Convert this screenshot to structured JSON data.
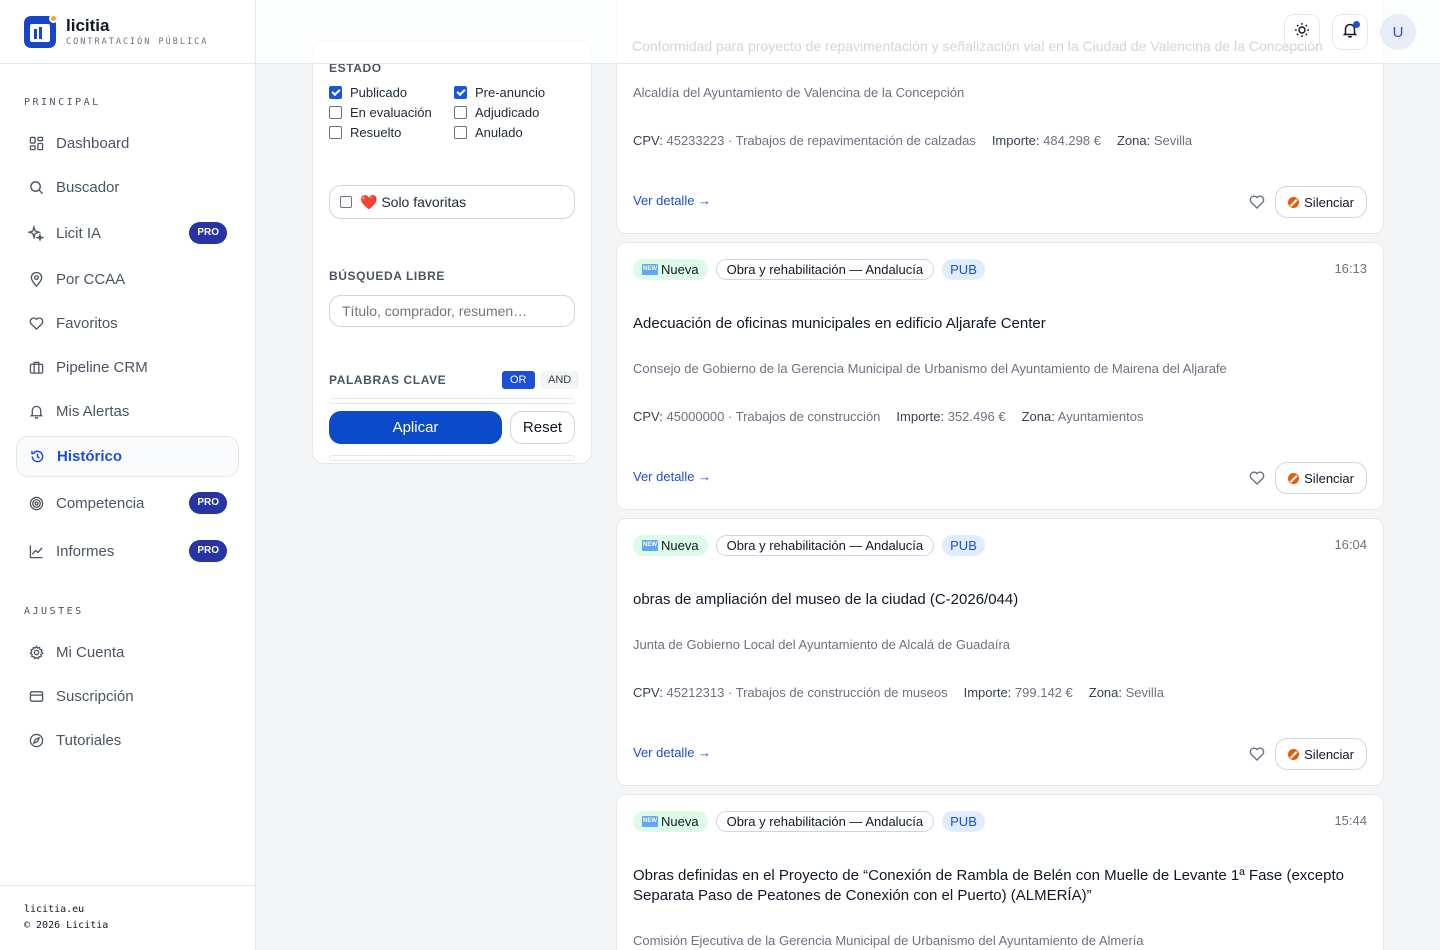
{
  "brand": {
    "name": "licitia",
    "subtitle": "CONTRATACIÓN PÚBLICA"
  },
  "sidebar": {
    "section_main": "PRINCIPAL",
    "section_settings": "AJUSTES",
    "items": [
      {
        "label": "Dashboard",
        "icon": "grid-icon"
      },
      {
        "label": "Buscador",
        "icon": "search-icon"
      },
      {
        "label": "Licit IA",
        "icon": "sparkle-icon",
        "badge": "PRO"
      },
      {
        "label": "Por CCAA",
        "icon": "map-pin-icon"
      },
      {
        "label": "Favoritos",
        "icon": "heart-icon"
      },
      {
        "label": "Pipeline CRM",
        "icon": "briefcase-icon"
      },
      {
        "label": "Mis Alertas",
        "icon": "bell-icon"
      },
      {
        "label": "Histórico",
        "icon": "history-icon",
        "active": true
      },
      {
        "label": "Competencia",
        "icon": "target-icon",
        "badge": "PRO"
      },
      {
        "label": "Informes",
        "icon": "chart-icon",
        "badge": "PRO"
      }
    ],
    "settings_items": [
      {
        "label": "Mi Cuenta",
        "icon": "gear-icon"
      },
      {
        "label": "Suscripción",
        "icon": "card-icon"
      },
      {
        "label": "Tutoriales",
        "icon": "compass-icon"
      }
    ],
    "footer": {
      "site": "licitia.eu",
      "copyright": "© 2026 Licitia"
    }
  },
  "header": {
    "avatar_initial": "U",
    "ghost_text": "Conformidad para proyecto de repavimentación y señalización vial en la Ciudad de Valencina de la Concepción"
  },
  "filters": {
    "estado_label": "ESTADO",
    "estados": [
      {
        "label": "Publicado",
        "checked": true
      },
      {
        "label": "Pre-anuncio",
        "checked": true
      },
      {
        "label": "En evaluación",
        "checked": false
      },
      {
        "label": "Adjudicado",
        "checked": false
      },
      {
        "label": "Resuelto",
        "checked": false
      },
      {
        "label": "Anulado",
        "checked": false
      }
    ],
    "favoritas_label": "❤️ Solo favoritas",
    "busqueda_label": "BÚSQUEDA LIBRE",
    "busqueda_placeholder": "Título, comprador, resumen…",
    "palabras_label": "PALABRAS CLAVE",
    "mode_or": "OR",
    "mode_and": "AND",
    "apply": "Aplicar",
    "reset": "Reset"
  },
  "common": {
    "new_label": "Nueva",
    "new_emoji": "NEW",
    "pub": "PUB",
    "detail_link": "Ver detalle →",
    "silence": "Silenciar",
    "cpv_label": "CPV:",
    "importe_label": "Importe:",
    "zona_label": "Zona:"
  },
  "cards": [
    {
      "org": "Alcaldía del Ayuntamiento de Valencina de la Concepción",
      "cpv": "45233223 · Trabajos de repavimentación de calzadas",
      "importe": "484.298 €",
      "zona": "Sevilla"
    },
    {
      "category": "Obra y rehabilitación — Andalucía",
      "time": "16:13",
      "title": "Adecuación de oficinas municipales en edificio Aljarafe Center",
      "org": "Consejo de Gobierno de la Gerencia Municipal de Urbanismo del Ayuntamiento de Mairena del Aljarafe",
      "cpv": "45000000 · Trabajos de construcción",
      "importe": "352.496 €",
      "zona": "Ayuntamientos"
    },
    {
      "category": "Obra y rehabilitación — Andalucía",
      "time": "16:04",
      "title": "obras de ampliación del museo de la ciudad (C-2026/044)",
      "org": "Junta de Gobierno Local del Ayuntamiento de Alcalá de Guadaíra",
      "cpv": "45212313 · Trabajos de construcción de museos",
      "importe": "799.142 €",
      "zona": "Sevilla"
    },
    {
      "category": "Obra y rehabilitación — Andalucía",
      "time": "15:44",
      "title": "Obras definidas en el Proyecto de “Conexión de Rambla de Belén con Muelle de Levante 1ª Fase (excepto Separata Paso de Peatones de Conexión con el Puerto) (ALMERÍA)”",
      "org": "Comisión Ejecutiva de la Gerencia Municipal de Urbanismo del Ayuntamiento de Almería"
    }
  ]
}
